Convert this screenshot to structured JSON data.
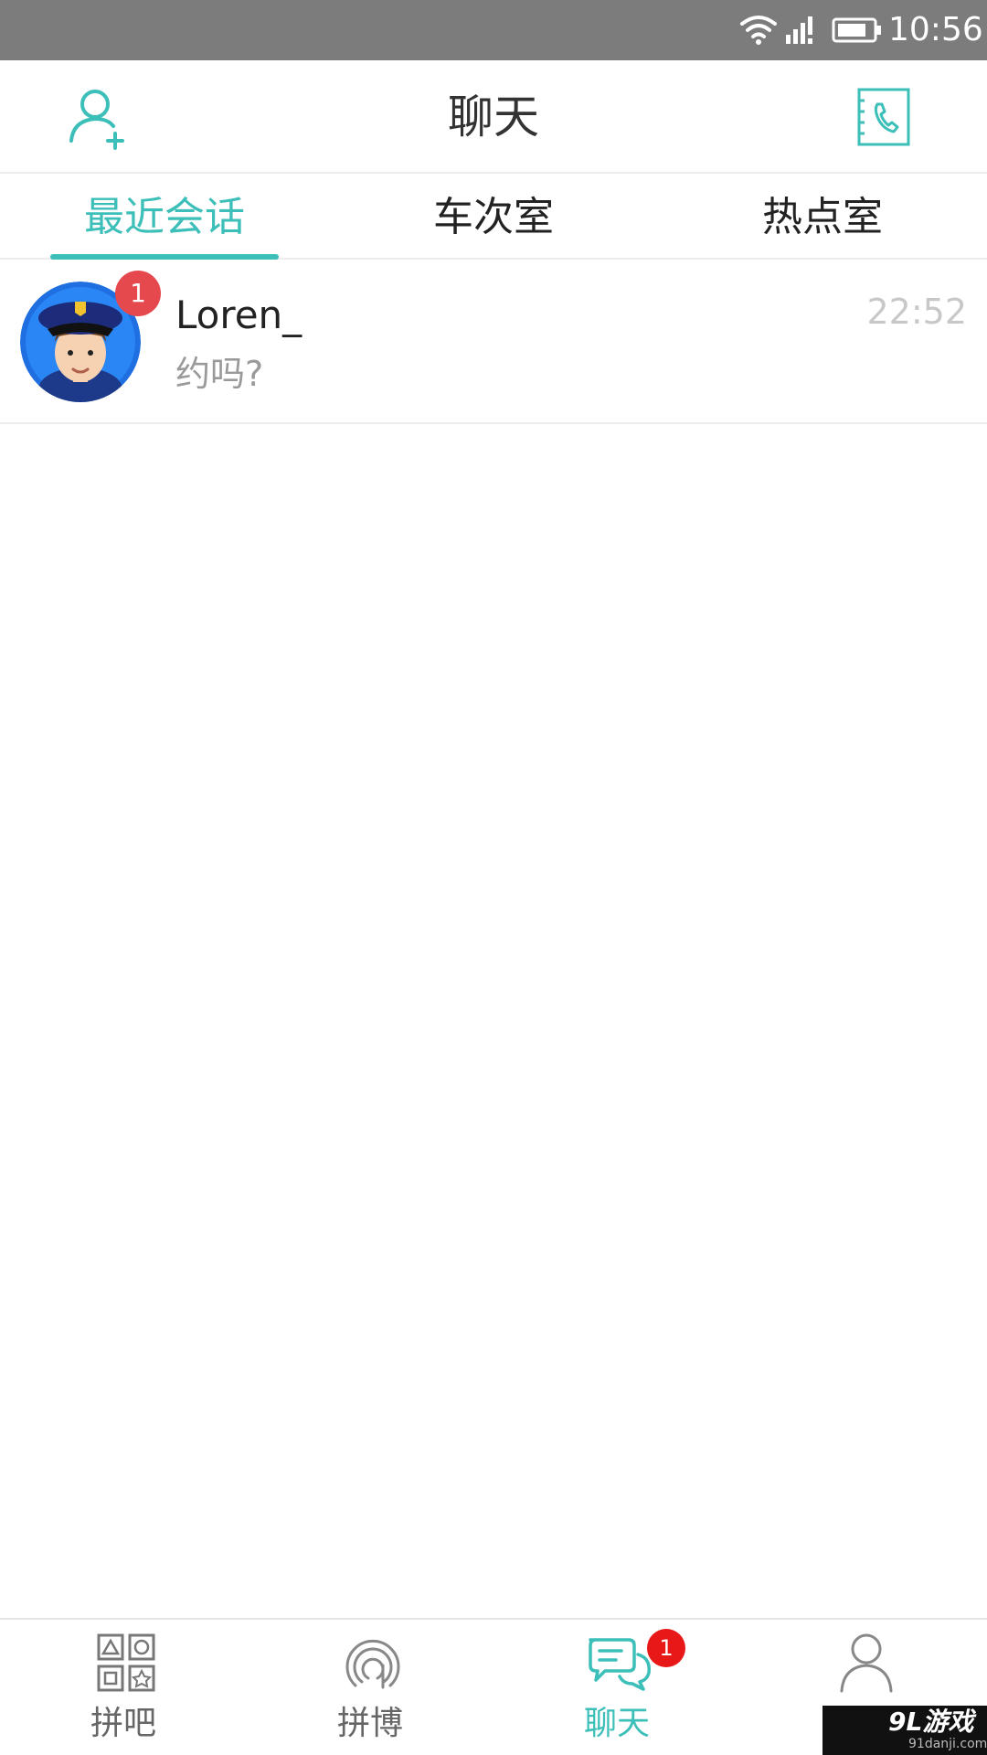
{
  "status_bar": {
    "time": "10:56",
    "icons": [
      "wifi-icon",
      "cellular-signal-icon",
      "battery-icon"
    ]
  },
  "header": {
    "title": "聊天",
    "left_icon": "add-friend-icon",
    "right_icon": "phone-contacts-icon"
  },
  "tabs": [
    {
      "label": "最近会话",
      "active": true
    },
    {
      "label": "车次室",
      "active": false
    },
    {
      "label": "热点室",
      "active": false
    }
  ],
  "conversations": [
    {
      "name": "Loren_",
      "last_message": "约吗?",
      "time": "22:52",
      "unread": "1",
      "avatar": "police-cartoon-avatar"
    }
  ],
  "bottom_nav": [
    {
      "label": "拼吧",
      "icon": "grid-shapes-icon",
      "active": false
    },
    {
      "label": "拼博",
      "icon": "broadcast-icon",
      "active": false
    },
    {
      "label": "聊天",
      "icon": "chat-bubbles-icon",
      "active": true,
      "badge": "1"
    },
    {
      "label": "",
      "icon": "profile-icon",
      "active": false
    }
  ],
  "watermark": {
    "main": "9L游戏",
    "sub": "91danji.com"
  },
  "colors": {
    "accent": "#3cbfb8",
    "badge": "#e5484d",
    "status_bar": "#7c7c7c"
  }
}
